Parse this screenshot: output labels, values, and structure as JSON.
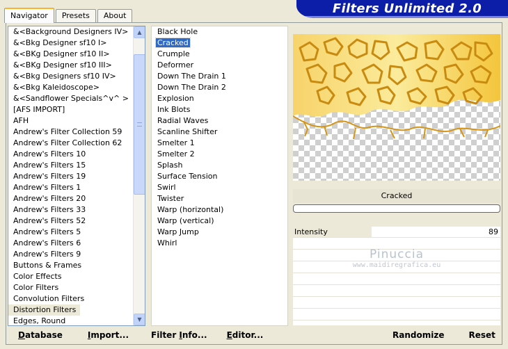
{
  "tabs": [
    {
      "label": "Navigator",
      "active": true
    },
    {
      "label": "Presets",
      "active": false
    },
    {
      "label": "About",
      "active": false
    }
  ],
  "brand": {
    "title": "Filters Unlimited 2.0"
  },
  "categories": {
    "items": [
      "&<Background Designers IV>",
      "&<Bkg Designer sf10 I>",
      "&<BKg Designer sf10 II>",
      "&<BKg Designer sf10 III>",
      "&<Bkg Designers sf10 IV>",
      "&<Bkg Kaleidoscope>",
      "&<Sandflower Specials^v^ >",
      "[AFS IMPORT]",
      "AFH",
      "Andrew's Filter Collection 59",
      "Andrew's Filter Collection 62",
      "Andrew's Filters 10",
      "Andrew's Filters 15",
      "Andrew's Filters 19",
      "Andrew's Filters 1",
      "Andrew's Filters 20",
      "Andrew's Filters 33",
      "Andrew's Filters 52",
      "Andrew's Filters 5",
      "Andrew's Filters 6",
      "Andrew's Filters 9",
      "Buttons & Frames",
      "Color Effects",
      "Color Filters",
      "Convolution Filters",
      "Distortion Filters",
      "Edges, Round"
    ],
    "selected": "Distortion Filters",
    "scroll_up_icon": "arrow-up-icon",
    "scroll_down_icon": "arrow-down-icon"
  },
  "filters": {
    "items": [
      "Black Hole",
      "Cracked",
      "Crumple",
      "Deformer",
      "Down The Drain 1",
      "Down The Drain 2",
      "Explosion",
      "Ink Blots",
      "Radial Waves",
      "Scanline Shifter",
      "Smelter 1",
      "Smelter 2",
      "Splash",
      "Surface Tension",
      "Swirl",
      "Twister",
      "Warp (horizontal)",
      "Warp (vertical)",
      "Warp Jump",
      "Whirl"
    ],
    "selected": "Cracked"
  },
  "preview": {
    "filter_name": "Cracked",
    "progress": 0,
    "colors": {
      "gold": "#e8b21c",
      "light": "#f9e39a"
    }
  },
  "sliders": [
    {
      "label": "Intensity",
      "value": "89",
      "fraction": 0.38
    }
  ],
  "watermark": {
    "name": "Pinuccia",
    "url": "www.maidiregrafica.eu"
  },
  "buttons": {
    "database": {
      "first": "D",
      "rest": "atabase"
    },
    "import": {
      "first": "I",
      "rest": "mport..."
    },
    "filter_info": {
      "pre": "Filter ",
      "first": "I",
      "rest": "nfo..."
    },
    "editor": {
      "first": "E",
      "rest": "ditor..."
    },
    "randomize": "Randomize",
    "reset": "Reset"
  }
}
